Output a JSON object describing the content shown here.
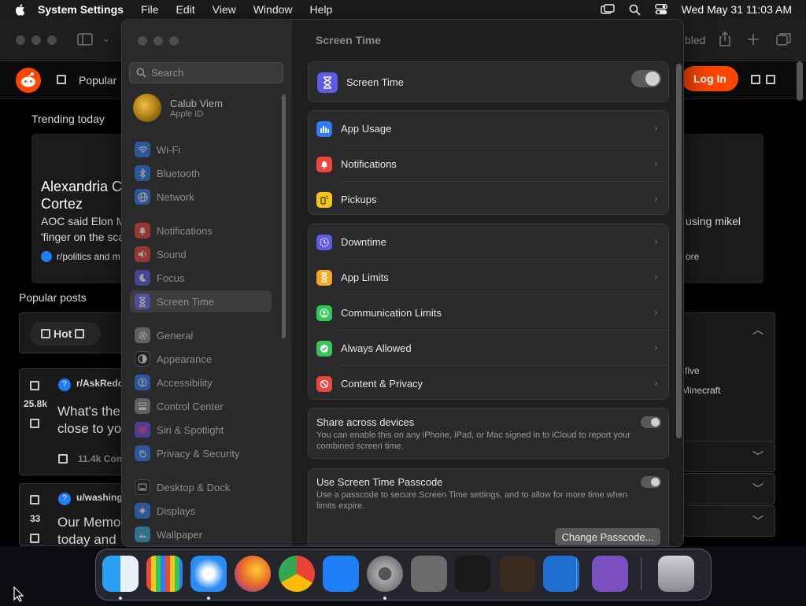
{
  "menubar": {
    "app_name": "System Settings",
    "menus": [
      "File",
      "Edit",
      "View",
      "Window",
      "Help"
    ],
    "datetime": "Wed May 31  11:03 AM",
    "icons": [
      "screen-mirroring-icon",
      "spotlight-search-icon",
      "control-center-icon"
    ]
  },
  "browser": {
    "nav": {
      "popular": "Popular",
      "login": "Log In",
      "tab_fragment": "bled"
    },
    "trending_title": "Trending today",
    "headline_line1": "Alexandria C",
    "headline_line2": "Cortez",
    "snippet_line1": "AOC said Elon M",
    "snippet_line2": "'finger on the sca",
    "subreddit": "r/politics and m",
    "right_snippet": "using mikel",
    "right_more": "ore",
    "popular_posts": "Popular posts",
    "hot": "Hot",
    "post1": {
      "sub": "r/AskRedc",
      "votes": "25.8k",
      "title1": "What's the",
      "title2": "close to yo",
      "comments": "11.4k Com"
    },
    "post2": {
      "sub": "u/washing",
      "votes": "33",
      "title1": "Our Memo",
      "title2": "today and"
    },
    "side_items": [
      "five",
      "Minecraft"
    ]
  },
  "settings": {
    "search_placeholder": "Search",
    "account": {
      "name": "Calub Viem",
      "subtitle": "Apple ID"
    },
    "sidebar": [
      {
        "label": "Wi-Fi",
        "icon": "wifi-icon",
        "color": "#2f7cf6"
      },
      {
        "label": "Bluetooth",
        "icon": "bluetooth-icon",
        "color": "#2f7cf6"
      },
      {
        "label": "Network",
        "icon": "globe-icon",
        "color": "#2f7cf6"
      },
      {
        "label": "Notifications",
        "icon": "bell-icon",
        "color": "#f0453a"
      },
      {
        "label": "Sound",
        "icon": "speaker-icon",
        "color": "#f0453a"
      },
      {
        "label": "Focus",
        "icon": "moon-icon",
        "color": "#5e5ce6"
      },
      {
        "label": "Screen Time",
        "icon": "hourglass-icon",
        "color": "#5e5ce6"
      },
      {
        "label": "General",
        "icon": "gear-icon",
        "color": "#8e8e93"
      },
      {
        "label": "Appearance",
        "icon": "appearance-icon",
        "color": "#1c1c1e"
      },
      {
        "label": "Accessibility",
        "icon": "accessibility-icon",
        "color": "#2f7cf6"
      },
      {
        "label": "Control Center",
        "icon": "control-center-icon",
        "color": "#8e8e93"
      },
      {
        "label": "Siri & Spotlight",
        "icon": "siri-icon",
        "color": "#c23ad6"
      },
      {
        "label": "Privacy & Security",
        "icon": "hand-icon",
        "color": "#2f7cf6"
      },
      {
        "label": "Desktop & Dock",
        "icon": "dock-icon",
        "color": "#1c1c1e"
      },
      {
        "label": "Displays",
        "icon": "display-icon",
        "color": "#2f7cf6"
      },
      {
        "label": "Wallpaper",
        "icon": "wallpaper-icon",
        "color": "#38b0de"
      }
    ],
    "page_title": "Screen Time",
    "main_toggle_label": "Screen Time",
    "group1": [
      {
        "label": "App Usage",
        "icon": "bar-chart-icon",
        "color": "#2f7cf6"
      },
      {
        "label": "Notifications",
        "icon": "bell-icon",
        "color": "#f0453a"
      },
      {
        "label": "Pickups",
        "icon": "pickups-icon",
        "color": "#f5c518"
      }
    ],
    "group2": [
      {
        "label": "Downtime",
        "icon": "downtime-icon",
        "color": "#5e5ce6"
      },
      {
        "label": "App Limits",
        "icon": "hourglass-icon",
        "color": "#f5a623"
      },
      {
        "label": "Communication Limits",
        "icon": "contact-icon",
        "color": "#34c759"
      },
      {
        "label": "Always Allowed",
        "icon": "checkmark-icon",
        "color": "#34c759"
      },
      {
        "label": "Content & Privacy",
        "icon": "prohibited-icon",
        "color": "#f0453a"
      }
    ],
    "share": {
      "title": "Share across devices",
      "desc": "You can enable this on any iPhone, iPad, or Mac signed in to iCloud to report your combined screen time."
    },
    "passcode": {
      "title": "Use Screen Time Passcode",
      "desc": "Use a passcode to secure Screen Time settings, and to allow for more time when limits expire.",
      "button": "Change Passcode..."
    }
  },
  "dock": {
    "apps": [
      {
        "name": "finder-icon",
        "color": "#1e8cf0"
      },
      {
        "name": "launchpad-icon",
        "color": "#d9d9e0"
      },
      {
        "name": "safari-icon",
        "color": "#2a8cf5"
      },
      {
        "name": "firefox-icon",
        "color": "#e8672a"
      },
      {
        "name": "chrome-icon",
        "color": "#3a9a44"
      },
      {
        "name": "app-store-icon",
        "color": "#1e7ef5"
      },
      {
        "name": "system-settings-icon",
        "color": "#8e8e93"
      },
      {
        "name": "script-editor-icon",
        "color": "#6b6b6b"
      },
      {
        "name": "terminal-icon",
        "color": "#1a1a1a"
      },
      {
        "name": "garageband-icon",
        "color": "#3a2a20"
      },
      {
        "name": "vscode-icon",
        "color": "#1f6fd1"
      },
      {
        "name": "visual-studio-icon",
        "color": "#7a4fc0"
      },
      {
        "name": "trash-icon",
        "color": "#9a9aa0"
      }
    ]
  }
}
